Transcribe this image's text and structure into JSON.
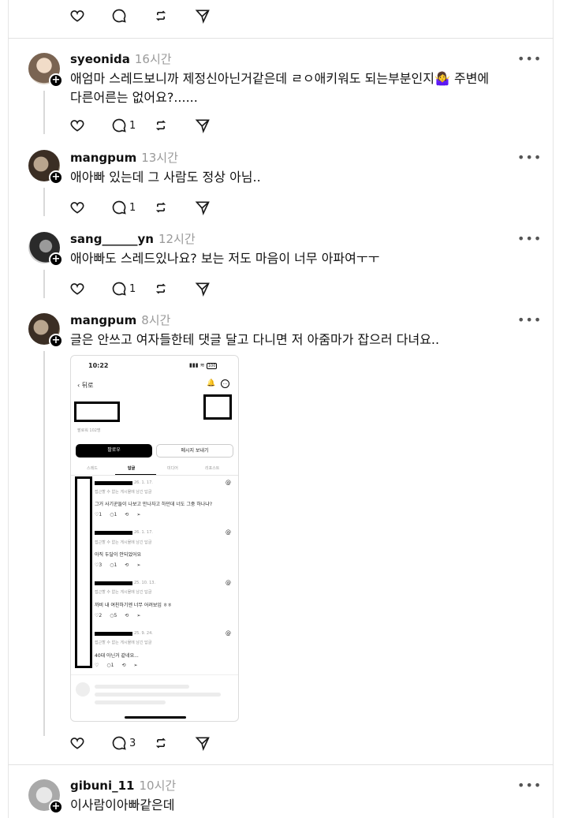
{
  "top_actions": {
    "like": "",
    "reply": "",
    "repost": "",
    "share": ""
  },
  "posts": [
    {
      "username": "syeonida",
      "time": "16시간",
      "text_line1": "애엄마 스레드보니까 제정신아닌거같은데 ㄹㅇ애키워도 되는부분인지",
      "emoji": "🤷‍♀️",
      "text_line1_tail": "주변에",
      "text_line2": "다른어른는 없어요?......",
      "reply_count": "1",
      "avatar_color": "#c8b4a0"
    },
    {
      "username": "mangpum",
      "time": "13시간",
      "text": "애아빠 있는데 그 사람도 정상 아님..",
      "reply_count": "1",
      "avatar_color": "#6b5a48"
    },
    {
      "username": "sang______yn",
      "time": "12시간",
      "text": "애아빠도 스레드있나요? 보는 저도 마음이 너무 아파여ㅜㅜ",
      "reply_count": "1",
      "avatar_color": "#3a3a3a"
    },
    {
      "username": "mangpum",
      "time": "8시간",
      "text": "글은 안쓰고 여자들한테 댓글 달고 다니면 저 아줌마가 잡으러 다녀요..",
      "reply_count": "3",
      "avatar_color": "#6b5a48"
    },
    {
      "username": "gibuni_11",
      "time": "10시간",
      "text": "이사람이아빠같은데",
      "avatar_color": "#bfbfbf"
    }
  ],
  "screenshot": {
    "status_time": "10:22",
    "battery": "100",
    "back_label": "뒤로",
    "followers": "팔로워 102명",
    "follow_button": "팔로우",
    "message_button": "메시지 보내기",
    "tabs": [
      "스레드",
      "답글",
      "미디어",
      "리포스트"
    ],
    "replies": [
      {
        "date": "26. 1. 17.",
        "context": "접근할 수 없는 게시물에 남긴 답글",
        "text": "그거 사기꾼들이 나보고 만나자고 하던데 너도 그중 하나냐?",
        "likes": "1",
        "comments": "1"
      },
      {
        "date": "26. 1. 17.",
        "context": "접근할 수 없는 게시물에 남긴 답글",
        "text": "아직 두달이 안되었어요",
        "likes": "3",
        "comments": "1"
      },
      {
        "date": "25. 10. 13.",
        "context": "접근할 수 없는 게시물에 남긴 답글",
        "text": "까비 내 여친하기엔 너무 어려보임 ㅎㅎ",
        "likes": "2",
        "comments": "5"
      },
      {
        "date": "25. 9. 24.",
        "context": "접근할 수 없는 게시물에 남긴 답글",
        "text": "40대 아닌거 같네요...",
        "likes": "",
        "comments": "1"
      }
    ]
  }
}
